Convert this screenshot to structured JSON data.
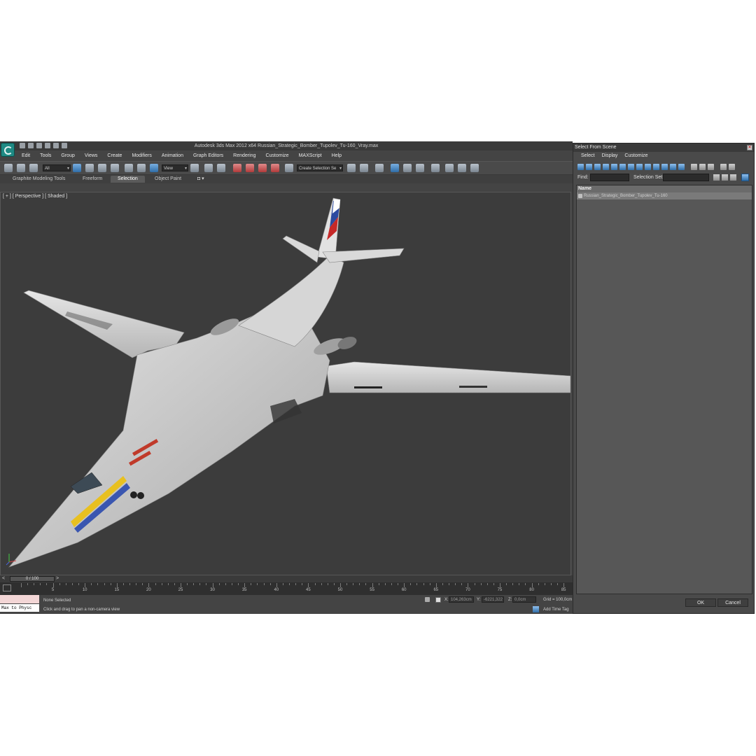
{
  "window": {
    "title": "Autodesk 3ds Max  2012 x64     Russian_Strategic_Bomber_Tupolev_Tu-160_Vray.max"
  },
  "menubar": [
    "Edit",
    "Tools",
    "Group",
    "Views",
    "Create",
    "Modifiers",
    "Animation",
    "Graph Editors",
    "Rendering",
    "Customize",
    "MAXScript",
    "Help"
  ],
  "toolbar": {
    "selection_filter": "All",
    "reference_coord": "View",
    "named_selection": "Create Selection Se"
  },
  "ribbon_tabs": [
    "Graphite Modeling Tools",
    "Freeform",
    "Selection",
    "Object Paint"
  ],
  "ribbon_active": "Selection",
  "viewport": {
    "label": "[ + ] [ Perspective ] [ Shaded ]"
  },
  "timeline": {
    "frame": "0 / 100",
    "ticks": [
      "5",
      "10",
      "15",
      "20",
      "25",
      "30",
      "35",
      "40",
      "45",
      "50",
      "55",
      "60",
      "65",
      "70",
      "75",
      "80",
      "85"
    ]
  },
  "status": {
    "maxscript": "Max to Physc",
    "selection": "None Selected",
    "prompt": "Click and drag to pan a non-camera view",
    "x_label": "X:",
    "x_value": "104,263cm",
    "y_label": "Y:",
    "y_value": "-6221,322",
    "z_label": "Z:",
    "z_value": "0,0cm",
    "grid": "Grid = 100,0cm",
    "add_time_tag": "Add Time Tag"
  },
  "dialog": {
    "title": "Select From Scene",
    "menu": [
      "Select",
      "Display",
      "Customize"
    ],
    "find_label": "Find:",
    "selection_set_label": "Selection Set:",
    "column_header": "Name",
    "rows": [
      "Russian_Strategic_Bomber_Tupolev_Tu-160"
    ],
    "ok": "OK",
    "cancel": "Cancel"
  }
}
